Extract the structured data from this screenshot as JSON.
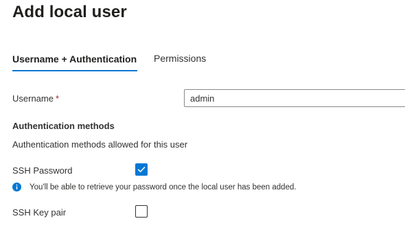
{
  "page": {
    "title": "Add local user"
  },
  "tabs": [
    {
      "label": "Username + Authentication",
      "active": true
    },
    {
      "label": "Permissions",
      "active": false
    }
  ],
  "username": {
    "label": "Username",
    "required_mark": "*",
    "value": "admin"
  },
  "auth": {
    "section_title": "Authentication methods",
    "description": "Authentication methods allowed for this user",
    "ssh_password": {
      "label": "SSH Password",
      "checked": true
    },
    "info": {
      "icon": "info-icon",
      "text": "You'll be able to retrieve your password once the local user has been added."
    },
    "ssh_key_pair": {
      "label": "SSH Key pair",
      "checked": false
    }
  },
  "colors": {
    "accent": "#0078d4",
    "required": "#a4262c",
    "text": "#323130"
  }
}
